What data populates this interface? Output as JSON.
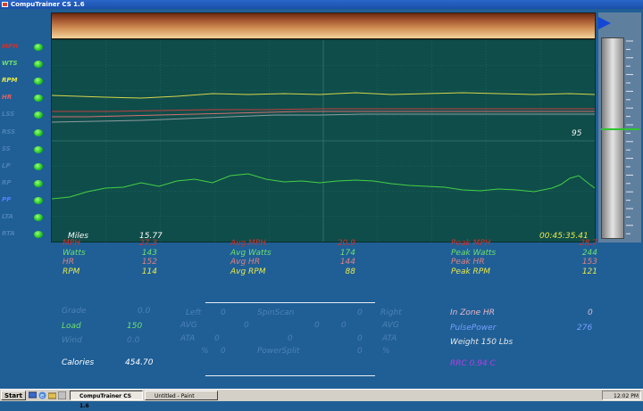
{
  "window": {
    "title": "CompuTrainer CS 1.6"
  },
  "channels": [
    {
      "label": "MPH",
      "color": "#d0302a"
    },
    {
      "label": "WTS",
      "color": "#6ee06a"
    },
    {
      "label": "RPM",
      "color": "#e8e84a"
    },
    {
      "label": "HR",
      "color": "#e06060"
    },
    {
      "label": "LSS",
      "color": "#4e81b3"
    },
    {
      "label": "RSS",
      "color": "#4e81b3"
    },
    {
      "label": "SS",
      "color": "#4e81b3"
    },
    {
      "label": "LP",
      "color": "#4e81b3"
    },
    {
      "label": "RP",
      "color": "#4e81b3"
    },
    {
      "label": "PP",
      "color": "#5080ff"
    },
    {
      "label": "LTA",
      "color": "#4e81b3"
    },
    {
      "label": "RTA",
      "color": "#4e81b3"
    }
  ],
  "scope": {
    "value_label": "95",
    "miles_label": "Miles",
    "miles_value": "15.77",
    "elapsed_time": "00:45:35.41"
  },
  "stats": {
    "current": [
      {
        "label": "MPH",
        "value": "27.3",
        "color": "#d0302a"
      },
      {
        "label": "Watts",
        "value": "143",
        "color": "#6ee06a"
      },
      {
        "label": "HR",
        "value": "152",
        "color": "#e08080"
      },
      {
        "label": "RPM",
        "value": "114",
        "color": "#e8e84a"
      }
    ],
    "average": [
      {
        "label": "Avg MPH",
        "value": "20.9",
        "color": "#d0302a"
      },
      {
        "label": "Avg Watts",
        "value": "174",
        "color": "#6ee06a"
      },
      {
        "label": "Avg HR",
        "value": "144",
        "color": "#e08080"
      },
      {
        "label": "Avg RPM",
        "value": "88",
        "color": "#e8e84a"
      }
    ],
    "peak": [
      {
        "label": "Peak MPH",
        "value": "28.7",
        "color": "#d0302a"
      },
      {
        "label": "Peak Watts",
        "value": "244",
        "color": "#6ee06a"
      },
      {
        "label": "Peak HR",
        "value": "153",
        "color": "#e08080"
      },
      {
        "label": "Peak RPM",
        "value": "121",
        "color": "#e8e84a"
      }
    ]
  },
  "left_panel": {
    "grade_label": "Grade",
    "grade_value": "0.0",
    "load_label": "Load",
    "load_value": "150",
    "wind_label": "Wind",
    "wind_value": "0.0",
    "calories_label": "Calories",
    "calories_value": "454.70"
  },
  "spinscan": {
    "left": "Left",
    "left_val": "0",
    "title": "SpinScan",
    "right_val": "0",
    "right": "Right",
    "avg_l": "AVG",
    "avg_v1": "0",
    "avg_v2": "0",
    "avg_v3": "0",
    "avg_r": "AVG",
    "ata_l": "ATA",
    "ata_v1": "0",
    "ata_v2": "0",
    "ata_v3": "0",
    "ata_r": "ATA",
    "pct_l": "%",
    "pct_v1": "0",
    "ps_title": "PowerSplit",
    "pct_v2": "0",
    "pct_r": "%"
  },
  "right_panel": {
    "zone_label": "In Zone HR",
    "zone_value": "0",
    "pulse_label": "PulsePower",
    "pulse_value": "276",
    "weight": "Weight 150 Lbs",
    "rrc": "RRC 0.94 C"
  },
  "taskbar": {
    "start": "Start",
    "tasks": [
      "CompuTrainer CS 1.6",
      "Untitled - Paint"
    ],
    "clock": "12:02 PM"
  },
  "colors": {
    "accent": "#1f5f96",
    "scope_bg": "#0f4d4a"
  }
}
